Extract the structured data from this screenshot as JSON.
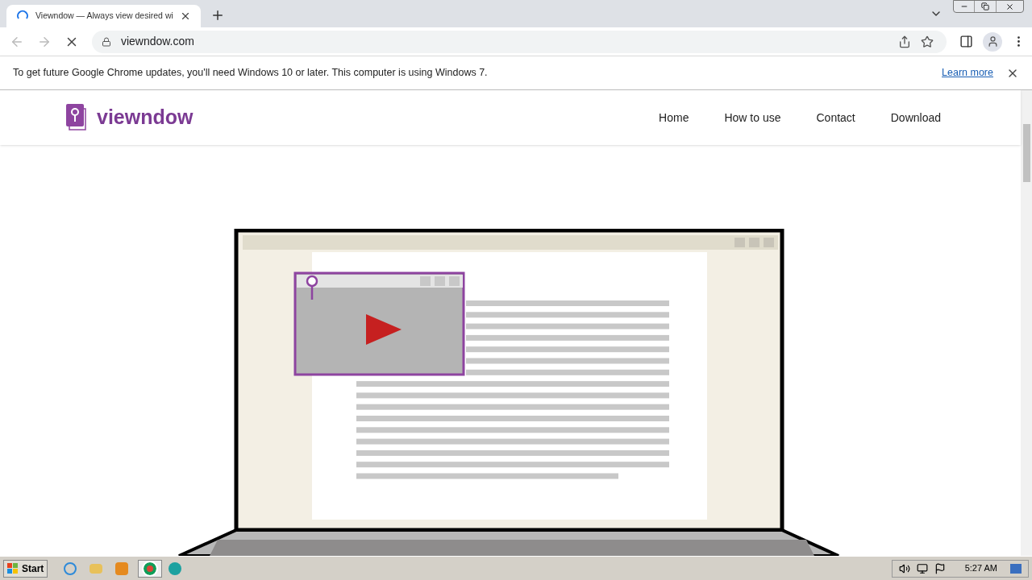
{
  "browser": {
    "tab": {
      "title": "Viewndow — Always view desired wi",
      "loading": true
    },
    "address": "viewndow.com"
  },
  "infobar": {
    "message": "To get future Google Chrome updates, you'll need Windows 10 or later. This computer is using Windows 7.",
    "link": "Learn more"
  },
  "site": {
    "logo": "viewndow",
    "nav": [
      "Home",
      "How to use",
      "Contact",
      "Download"
    ]
  },
  "taskbar": {
    "start": "Start",
    "clock": "5:27 AM"
  }
}
